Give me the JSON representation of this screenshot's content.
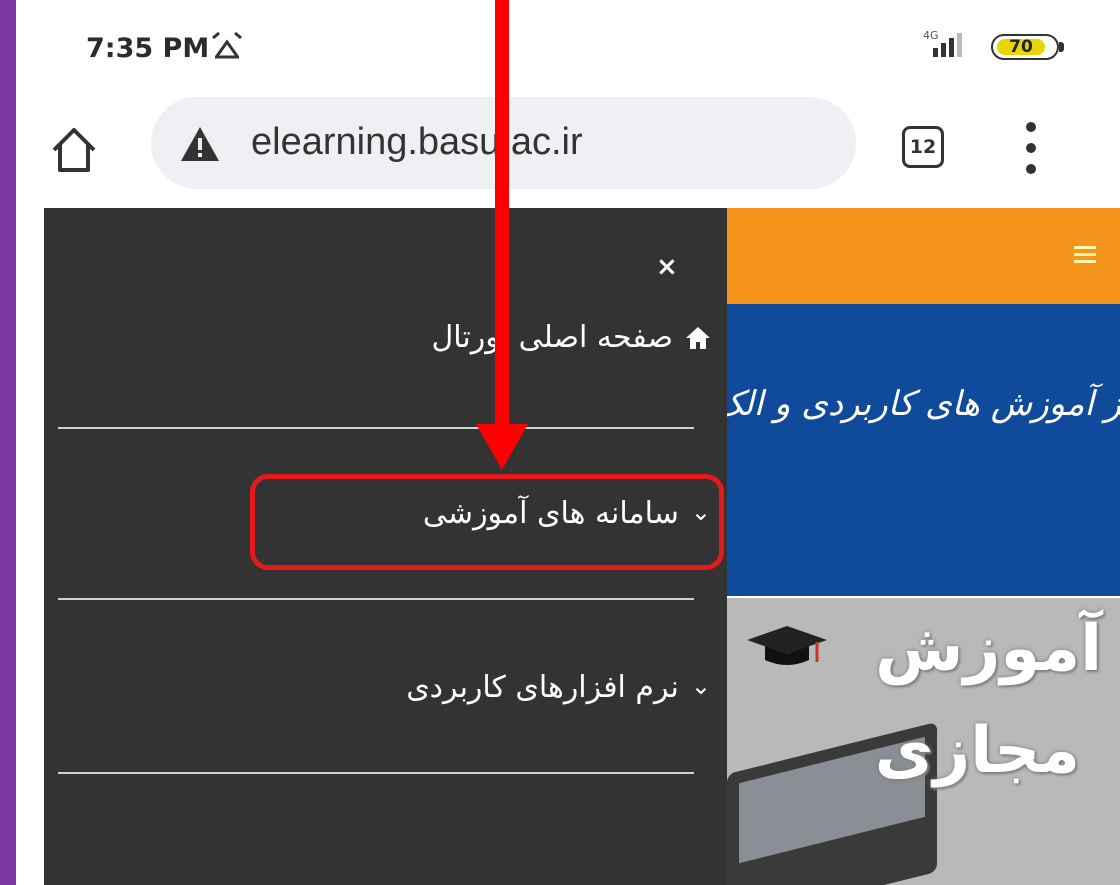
{
  "status_bar": {
    "time": "7:35 PM",
    "network": "4G",
    "battery": "70"
  },
  "browser": {
    "url": "elearning.basu.ac.ir",
    "tab_count": "12"
  },
  "drawer": {
    "close_label": "×",
    "items": [
      {
        "label": "صفحه اصلی پورتال",
        "icon": "home-icon"
      },
      {
        "label": "سامانه های آموزشی",
        "icon": "chevron-down-icon"
      },
      {
        "label": "نرم افزارهای کاربردی",
        "icon": "chevron-down-icon"
      }
    ]
  },
  "site": {
    "banner_text": "مرکز آموزش های کاربردی و الک",
    "promo_line1": "آموزش",
    "promo_line2": "مجازی"
  },
  "colors": {
    "outer_background": "#7b36a3",
    "drawer_background": "#333333",
    "header_orange": "#f6951c",
    "banner_blue": "#0f4a9b",
    "annotation_red": "#ff0000"
  }
}
